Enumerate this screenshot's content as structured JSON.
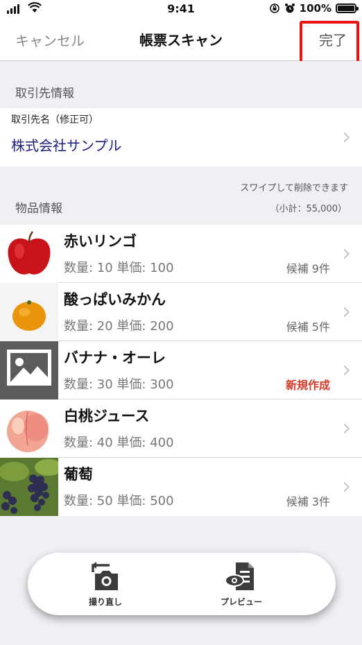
{
  "status_bar": {
    "time": "9:41",
    "battery": "100%"
  },
  "nav": {
    "cancel": "キャンセル",
    "title": "帳票スキャン",
    "done": "完了"
  },
  "partner_section": {
    "header": "取引先情報",
    "field_label": "取引先名（修正可）",
    "field_value": "株式会社サンプル"
  },
  "items_section": {
    "header": "物品情報",
    "swipe_hint": "スワイプして削除できます",
    "subtotal": "（小計：55,000）"
  },
  "products": [
    {
      "name": "赤いリンゴ",
      "detail": "数量: 10 単価: 100",
      "status": "候補 9件",
      "status_type": "candidate",
      "thumbnail": "red-apple"
    },
    {
      "name": "酸っぱいみかん",
      "detail": "数量: 20 単価: 200",
      "status": "候補 5件",
      "status_type": "candidate",
      "thumbnail": "mandarin"
    },
    {
      "name": "バナナ・オーレ",
      "detail": "数量: 30 単価: 300",
      "status": "新規作成",
      "status_type": "new",
      "thumbnail": "image-placeholder"
    },
    {
      "name": "白桃ジュース",
      "detail": "数量: 40 単価: 400",
      "status": "",
      "status_type": "none",
      "thumbnail": "peach"
    },
    {
      "name": "葡萄",
      "detail": "数量: 50 単価: 500",
      "status": "候補 3件",
      "status_type": "candidate",
      "thumbnail": "grapes"
    }
  ],
  "actions": {
    "retake": "撮り直し",
    "preview": "プレビュー"
  },
  "colors": {
    "highlight": "#e81414",
    "new_status": "#d63a2b",
    "partner_value": "#1d1d7a"
  }
}
